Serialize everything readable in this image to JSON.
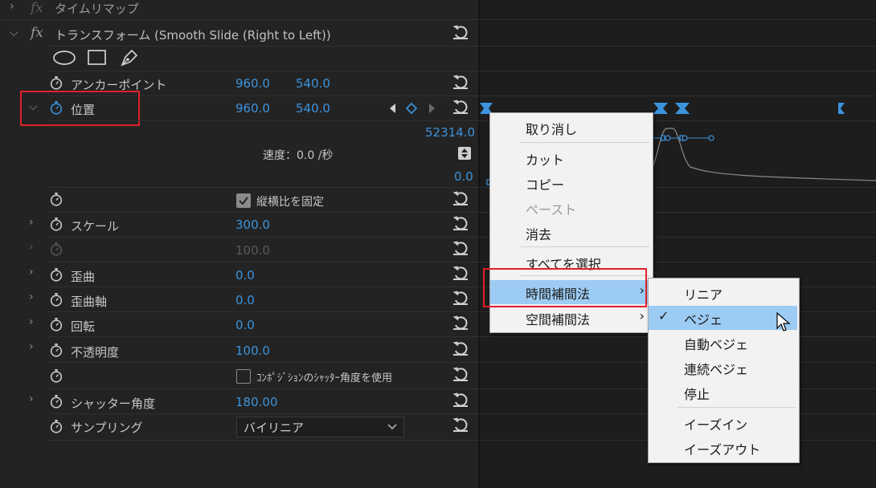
{
  "effects": {
    "time_remap": {
      "label": "タイムリマップ"
    },
    "transform": {
      "label": "トランスフォーム (Smooth Slide (Right to Left))"
    }
  },
  "properties": {
    "anchor": {
      "label": "アンカーポイント",
      "x": "960.0",
      "y": "540.0"
    },
    "position": {
      "label": "位置",
      "x": "960.0",
      "y": "540.0"
    },
    "graph": {
      "max": "52314.0",
      "speed": "速度：0.0 /秒",
      "min": "0.0"
    },
    "uniform_scale": {
      "label": "縦横比を固定"
    },
    "scale": {
      "label": "スケール",
      "value": "300.0"
    },
    "scale_width": {
      "value": "100.0"
    },
    "skew": {
      "label": "歪曲",
      "value": "0.0"
    },
    "skew_axis": {
      "label": "歪曲軸",
      "value": "0.0"
    },
    "rotation": {
      "label": "回転",
      "value": "0.0"
    },
    "opacity": {
      "label": "不透明度",
      "value": "100.0"
    },
    "shutter_comp": {
      "label": "ｺﾝﾎﾟｼﾞｼｮﾝのｼｬｯﾀｰ角度を使用"
    },
    "shutter_angle": {
      "label": "シャッター角度",
      "value": "180.00"
    },
    "sampling": {
      "label": "サンプリング",
      "value": "バイリニア"
    }
  },
  "context_menu": {
    "undo": "取り消し",
    "cut": "カット",
    "copy": "コピー",
    "paste": "ペースト",
    "clear": "消去",
    "select_all": "すべてを選択",
    "temporal": "時間補間法",
    "spatial": "空間補間法"
  },
  "submenu": {
    "linear": "リニア",
    "bezier": "ベジェ",
    "auto_bezier": "自動ベジェ",
    "continuous_bezier": "連続ベジェ",
    "hold": "停止",
    "ease_in": "イーズイン",
    "ease_out": "イーズアウト"
  },
  "colors": {
    "value_blue": "#3c93dc",
    "highlight": "#9ccbf3",
    "annotation_red": "#e0202c"
  }
}
